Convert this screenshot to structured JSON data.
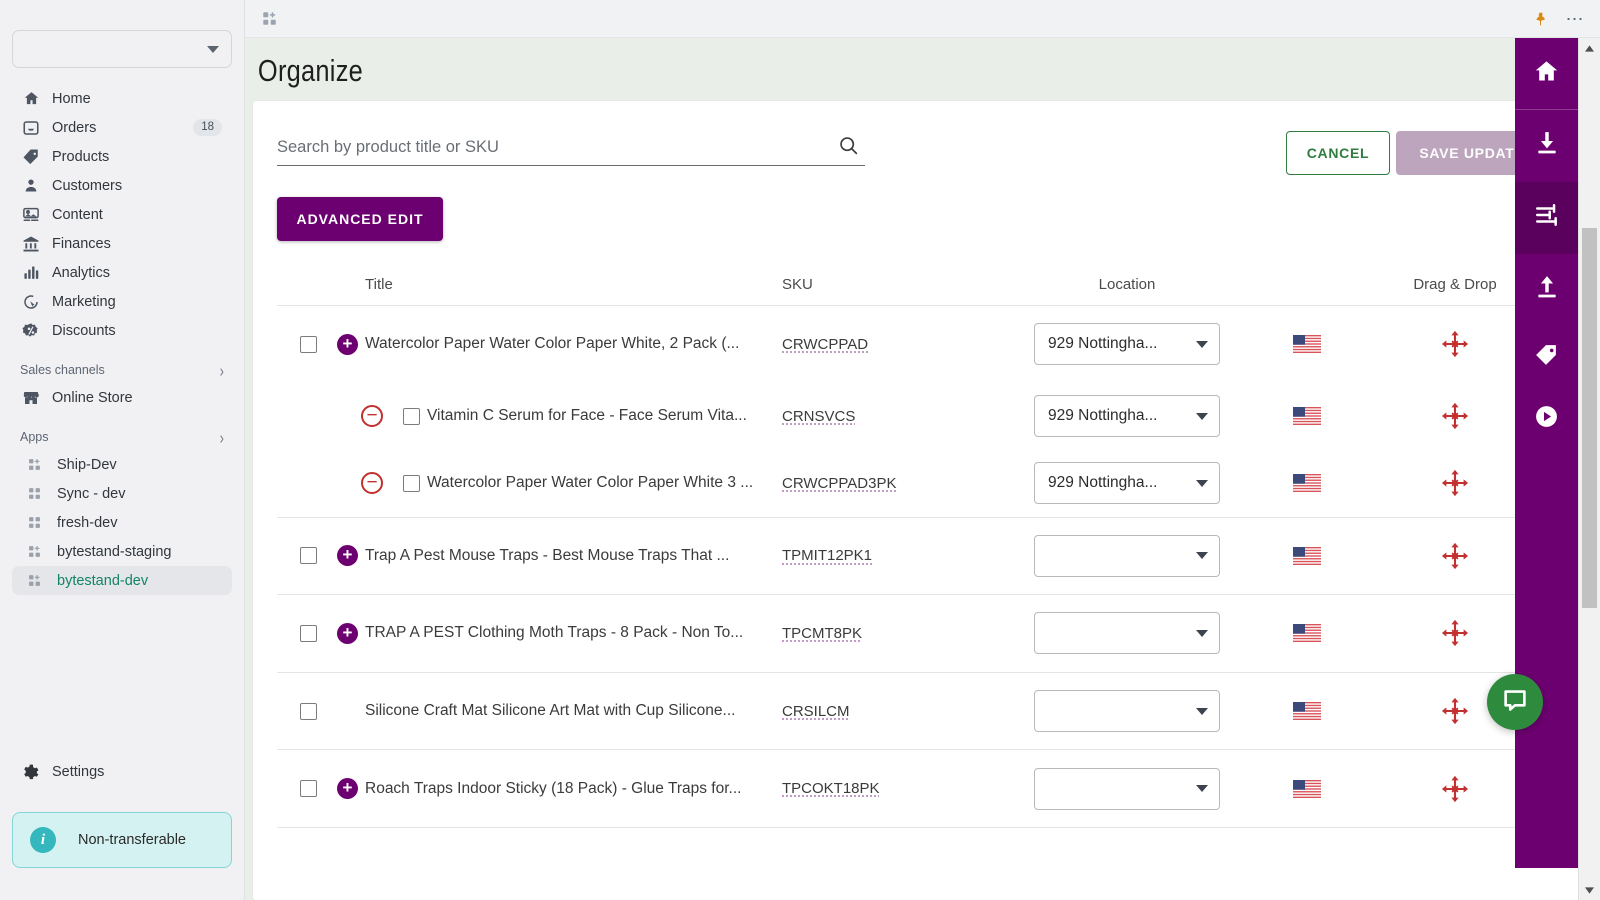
{
  "sidebar": {
    "store_select_value": "",
    "nav": [
      {
        "label": "Home",
        "icon": "home-icon",
        "badge": ""
      },
      {
        "label": "Orders",
        "icon": "orders-icon",
        "badge": "18"
      },
      {
        "label": "Products",
        "icon": "tag-icon",
        "badge": ""
      },
      {
        "label": "Customers",
        "icon": "person-icon",
        "badge": ""
      },
      {
        "label": "Content",
        "icon": "image-icon",
        "badge": ""
      },
      {
        "label": "Finances",
        "icon": "bank-icon",
        "badge": ""
      },
      {
        "label": "Analytics",
        "icon": "bar-chart-icon",
        "badge": ""
      },
      {
        "label": "Marketing",
        "icon": "megaphone-icon",
        "badge": ""
      },
      {
        "label": "Discounts",
        "icon": "percent-icon",
        "badge": ""
      }
    ],
    "sales_channels_header": "Sales channels",
    "sales_channels": [
      {
        "label": "Online Store",
        "icon": "store-icon"
      }
    ],
    "apps_header": "Apps",
    "apps": [
      {
        "label": "Ship-Dev",
        "icon": "app-icon",
        "active": false
      },
      {
        "label": "Sync - dev",
        "icon": "app-icon",
        "active": false
      },
      {
        "label": "fresh-dev",
        "icon": "app-icon",
        "active": false
      },
      {
        "label": "bytestand-staging",
        "icon": "app-icon",
        "active": false
      },
      {
        "label": "bytestand-dev",
        "icon": "app-icon",
        "active": true
      }
    ],
    "settings_label": "Settings",
    "badge": {
      "label": "Non-transferable",
      "icon": "info-icon"
    }
  },
  "topbar": {
    "apps_grid_icon": "apps-grid-plus-icon",
    "pin_icon": "pin-icon",
    "overflow_icon": "more-horizontal-icon"
  },
  "page": {
    "title": "Organize"
  },
  "search": {
    "placeholder": "Search by product title or SKU",
    "value": "",
    "icon": "search-icon"
  },
  "buttons": {
    "cancel": "CANCEL",
    "save_updates": "SAVE UPDATES",
    "advanced_edit": "ADVANCED EDIT"
  },
  "table": {
    "headers": {
      "title": "Title",
      "sku": "SKU",
      "location": "Location",
      "drag_drop": "Drag & Drop"
    },
    "rows": [
      {
        "type": "root",
        "expander": "plus",
        "title": "Watercolor Paper Water Color Paper White, 2 Pack (...",
        "sku": "CRWCPPAD",
        "location": "929 Nottingha...",
        "flag": "us-flag-icon",
        "drag": "drag-move-icon"
      },
      {
        "type": "child",
        "expander": "minus",
        "title": "Vitamin C Serum for Face - Face Serum Vita...",
        "sku": "CRNSVCS",
        "location": "929 Nottingha...",
        "flag": "us-flag-icon",
        "drag": "drag-move-icon"
      },
      {
        "type": "child",
        "expander": "minus",
        "title": "Watercolor Paper Water Color Paper White 3 ...",
        "sku": "CRWCPPAD3PK",
        "location": "929 Nottingha...",
        "flag": "us-flag-icon",
        "drag": "drag-move-icon"
      },
      {
        "type": "root",
        "expander": "plus",
        "title": "Trap A Pest Mouse Traps - Best Mouse Traps That ...",
        "sku": "TPMIT12PK1",
        "location": "",
        "flag": "us-flag-icon",
        "drag": "drag-move-icon"
      },
      {
        "type": "root",
        "expander": "plus",
        "title": "TRAP A PEST Clothing Moth Traps - 8 Pack - Non To...",
        "sku": "TPCMT8PK",
        "location": "",
        "flag": "us-flag-icon",
        "drag": "drag-move-icon"
      },
      {
        "type": "root",
        "expander": "none",
        "title": "Silicone Craft Mat Silicone Art Mat with Cup Silicone...",
        "sku": "CRSILCM",
        "location": "",
        "flag": "us-flag-icon",
        "drag": "drag-move-icon"
      },
      {
        "type": "root",
        "expander": "plus",
        "title": "Roach Traps Indoor Sticky (18 Pack) - Glue Traps for...",
        "sku": "TPCOKT18PK",
        "location": "",
        "flag": "us-flag-icon",
        "drag": "drag-move-icon"
      }
    ]
  },
  "rail": {
    "items": [
      {
        "icon": "home-icon",
        "active": false,
        "sep": true
      },
      {
        "icon": "download-icon",
        "active": false,
        "sep": false
      },
      {
        "icon": "sliders-icon",
        "active": true,
        "sep": false
      },
      {
        "icon": "upload-icon",
        "active": false,
        "sep": false
      },
      {
        "icon": "tag-icon",
        "active": false,
        "sep": false
      },
      {
        "icon": "play-icon",
        "active": false,
        "sep": false
      }
    ]
  },
  "chat": {
    "icon": "chat-bubble-icon"
  },
  "colors": {
    "brand_purple": "#6d0070",
    "accent_green": "#2e8b3e",
    "page_bg": "#e9efe8",
    "sidebar_bg": "#f1f1f3",
    "active_app_green": "#128467",
    "info_teal": "#34b7bd",
    "save_disabled": "#bda6bd",
    "cancel_green": "#2f7d3f",
    "drag_red": "#c2302f"
  }
}
